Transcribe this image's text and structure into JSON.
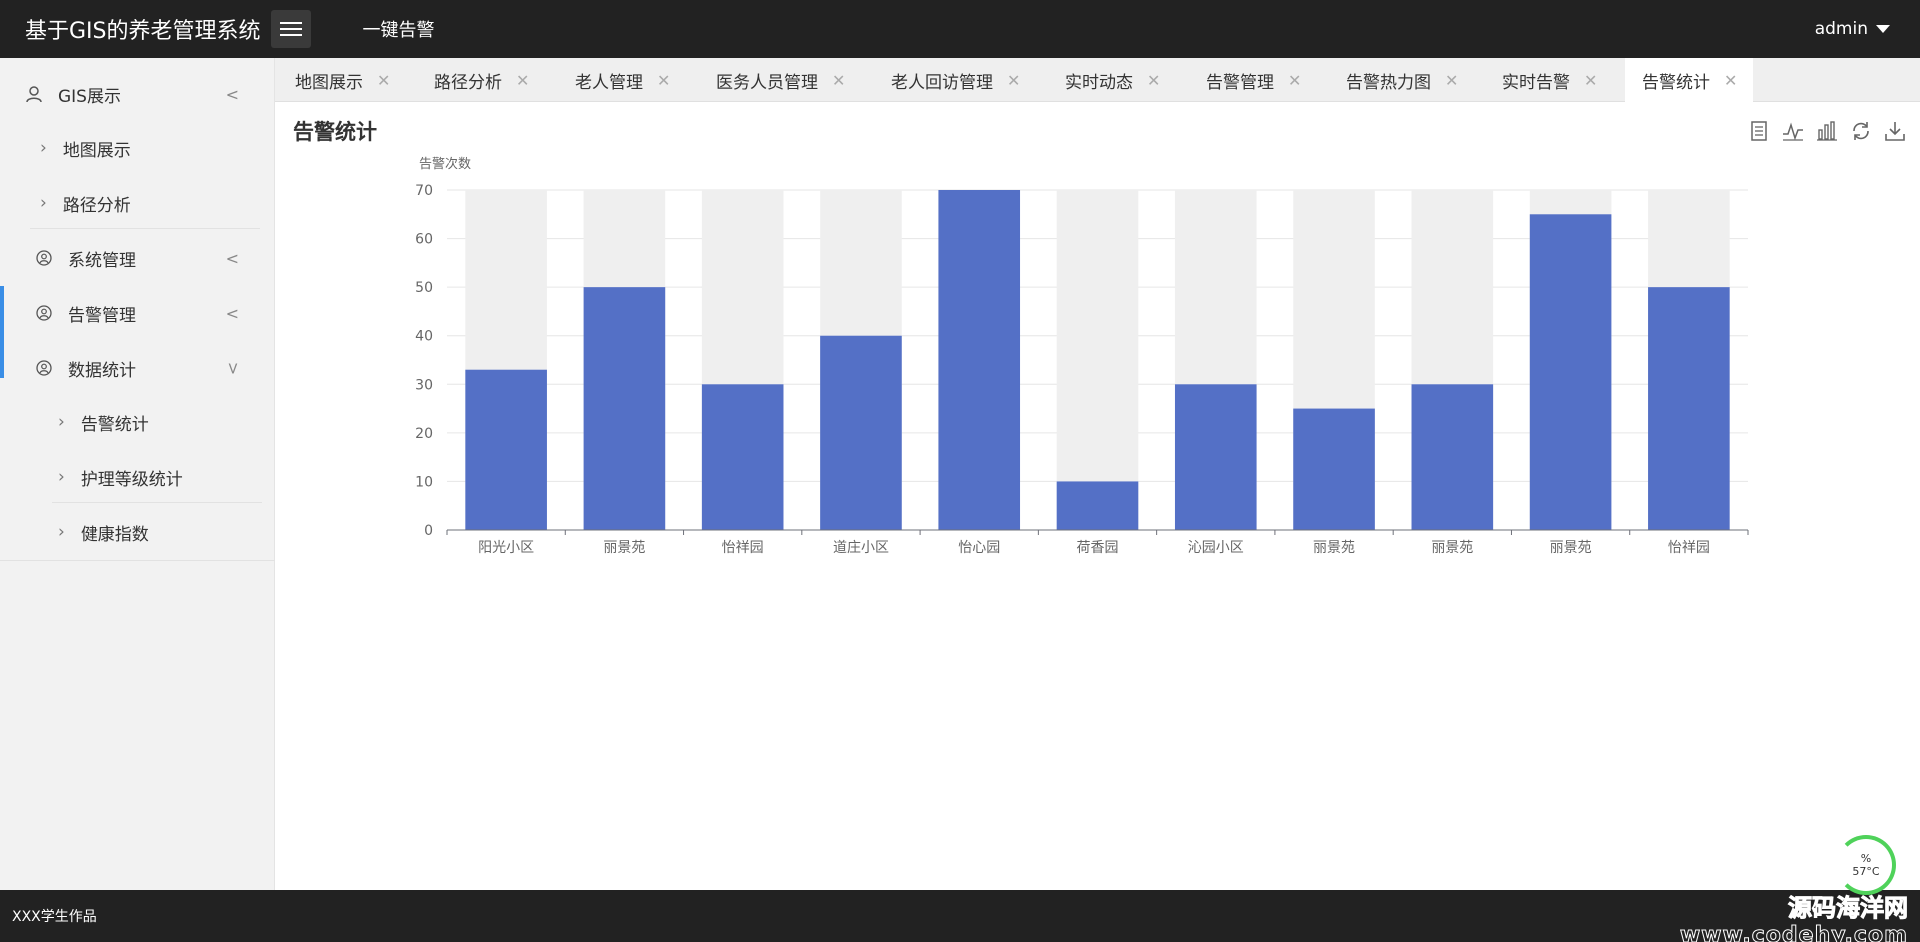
{
  "header": {
    "title": "基于GIS的养老管理系统",
    "alarm_link": "一键告警",
    "user": "admin"
  },
  "sidebar": {
    "items": [
      {
        "label": "GIS展示",
        "icon": "user-icon"
      },
      {
        "label": "地图展示"
      },
      {
        "label": "路径分析"
      },
      {
        "label": "系统管理",
        "icon": "user-circle-icon"
      },
      {
        "label": "告警管理",
        "icon": "user-circle-icon"
      },
      {
        "label": "数据统计",
        "icon": "user-circle-icon"
      },
      {
        "label": "告警统计"
      },
      {
        "label": "护理等级统计"
      },
      {
        "label": "健康指数"
      }
    ]
  },
  "tabs": [
    {
      "label": "地图展示"
    },
    {
      "label": "路径分析"
    },
    {
      "label": "老人管理"
    },
    {
      "label": "医务人员管理"
    },
    {
      "label": "老人回访管理"
    },
    {
      "label": "实时动态"
    },
    {
      "label": "告警管理"
    },
    {
      "label": "告警热力图"
    },
    {
      "label": "实时告警"
    },
    {
      "label": "告警统计"
    }
  ],
  "page": {
    "title": "告警统计"
  },
  "toolbox": [
    "data-view-icon",
    "line-chart-icon",
    "bar-chart-icon",
    "refresh-icon",
    "download-icon"
  ],
  "chart_data": {
    "type": "bar",
    "ylabel": "告警次数",
    "ylim": [
      0,
      70
    ],
    "yticks": [
      0,
      10,
      20,
      30,
      40,
      50,
      60,
      70
    ],
    "categories": [
      "阳光小区",
      "丽景苑",
      "怡祥园",
      "道庄小区",
      "怡心园",
      "荷香园",
      "沁园小区",
      "丽景苑",
      "丽景苑",
      "丽景苑",
      "怡祥园"
    ],
    "values": [
      33,
      50,
      30,
      40,
      70,
      10,
      30,
      25,
      30,
      65,
      50
    ],
    "bar_color": "#5470c6",
    "background_color": "#efefef",
    "grid": true
  },
  "footer": {
    "text": "XXX学生作品"
  },
  "watermark": {
    "cn": "源码海洋网",
    "en": "www.codehy.com"
  },
  "monitor": {
    "percent": "%",
    "temp": "57°C"
  }
}
